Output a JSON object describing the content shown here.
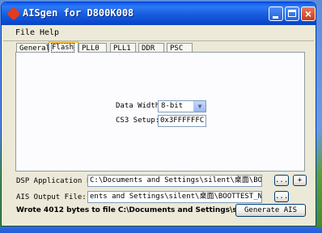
{
  "window": {
    "title": "AISgen for D800K008"
  },
  "menu": [
    "File",
    "Help"
  ],
  "tabs": [
    "General",
    "Flash",
    "PLL0",
    "PLL1",
    "DDR",
    "PSC"
  ],
  "flash": {
    "data_width_label": "Data Width:",
    "data_width_value": "8-bit",
    "cs3_label": "CS3 Setup:",
    "cs3_value": "0x3FFFFFFC"
  },
  "files": {
    "dsp_label": "DSP Application File:",
    "dsp_value": "C:\\Documents and Settings\\silent\\桌面\\BOOTTEST.",
    "ais_label": "AIS Output File:",
    "ais_value": "ents and Settings\\silent\\桌面\\BOOTTEST_NAND.ais",
    "browse_label": "...",
    "add_label": "+"
  },
  "status": "Wrote 4012 bytes to file C:\\Documents and Settings\\sil...",
  "generate_label": "Generate AIS"
}
